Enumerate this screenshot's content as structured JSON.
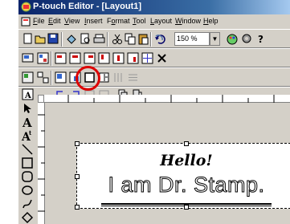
{
  "app": {
    "title": "P-touch Editor - [Layout1]"
  },
  "menu": [
    {
      "label": "File",
      "accel": "F"
    },
    {
      "label": "Edit",
      "accel": "E"
    },
    {
      "label": "View",
      "accel": "V"
    },
    {
      "label": "Insert",
      "accel": "I"
    },
    {
      "label": "Format",
      "accel": "o"
    },
    {
      "label": "Tool",
      "accel": "T"
    },
    {
      "label": "Layout",
      "accel": "L"
    },
    {
      "label": "Window",
      "accel": "W"
    },
    {
      "label": "Help",
      "accel": "H"
    }
  ],
  "toolbar": {
    "zoom": "150 %",
    "text_tool": "T"
  },
  "left_tools": [
    "select-arrow-icon",
    "text-tool",
    "vertical-text-tool",
    "line-icon",
    "rectangle-icon",
    "rounded-rectangle-icon",
    "ellipse-icon",
    "freehand-icon",
    "polygon-icon"
  ],
  "label": {
    "line1": "Hello!",
    "line2": "I am Dr. Stamp."
  },
  "colors": {
    "titlebar": "#0a246a",
    "highlight": "#dd0000",
    "chrome": "#d4d0c8"
  }
}
